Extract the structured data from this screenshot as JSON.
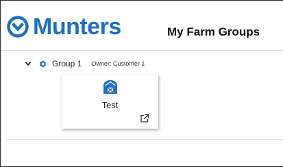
{
  "brand": {
    "name": "Munters",
    "color": "#1e6fc1"
  },
  "header": {
    "title": "My Farm Groups"
  },
  "groups": [
    {
      "name": "Group 1",
      "owner": "Owner: Customer 1",
      "expanded": true,
      "icons": {
        "toggle": "chevron-down-icon",
        "settings": "gear-icon"
      },
      "farms": [
        {
          "name": "Test",
          "icon": "barn-icon",
          "action_icon": "external-link-icon"
        }
      ]
    }
  ]
}
